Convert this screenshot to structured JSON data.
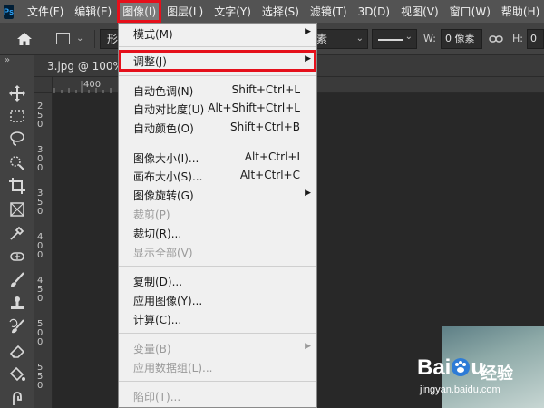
{
  "menubar": {
    "logo": "Ps",
    "items": [
      {
        "label": "文件(F)"
      },
      {
        "label": "编辑(E)"
      },
      {
        "label": "图像(I)"
      },
      {
        "label": "图层(L)"
      },
      {
        "label": "文字(Y)"
      },
      {
        "label": "选择(S)"
      },
      {
        "label": "滤镜(T)"
      },
      {
        "label": "3D(D)"
      },
      {
        "label": "视图(V)"
      },
      {
        "label": "窗口(W)"
      },
      {
        "label": "帮助(H)"
      }
    ],
    "active_item": "图像(I)",
    "highlight_color": "#e5101b"
  },
  "options_bar": {
    "home_icon": "home-icon",
    "shape_icon": "rectangle-icon",
    "mode_value": "形",
    "unit_value": "素",
    "stroke_icon": "stroke-line-icon",
    "w_label": "W:",
    "w_value": "0 像素",
    "link_icon": "link-icon",
    "h_label": "H:",
    "h_value": "0"
  },
  "toolbar": {
    "collapse": "»",
    "tools": [
      "move-icon",
      "marquee-icon",
      "lasso-icon",
      "quick-select-icon",
      "crop-icon",
      "frame-icon",
      "eyedropper-icon",
      "healing-brush-icon",
      "brush-icon",
      "clone-stamp-icon",
      "history-brush-icon",
      "eraser-icon",
      "paint-bucket-icon",
      "smudge-icon"
    ]
  },
  "document": {
    "tab_label": "3.jpg @ 100%(",
    "ruler_top": [
      "400"
    ],
    "ruler_left": [
      "250",
      "300",
      "350",
      "400",
      "450",
      "500",
      "550"
    ]
  },
  "image_menu": {
    "items": [
      {
        "label": "模式(M)",
        "submenu": true
      },
      {
        "label": "调整(J)",
        "submenu": true,
        "highlight": true
      },
      {
        "label": "自动色调(N)",
        "shortcut": "Shift+Ctrl+L"
      },
      {
        "label": "自动对比度(U)",
        "shortcut": "Alt+Shift+Ctrl+L"
      },
      {
        "label": "自动颜色(O)",
        "shortcut": "Shift+Ctrl+B"
      },
      {
        "label": "图像大小(I)...",
        "shortcut": "Alt+Ctrl+I"
      },
      {
        "label": "画布大小(S)...",
        "shortcut": "Alt+Ctrl+C"
      },
      {
        "label": "图像旋转(G)",
        "submenu": true
      },
      {
        "label": "裁剪(P)",
        "disabled": true
      },
      {
        "label": "裁切(R)..."
      },
      {
        "label": "显示全部(V)",
        "disabled": true
      },
      {
        "label": "复制(D)..."
      },
      {
        "label": "应用图像(Y)..."
      },
      {
        "label": "计算(C)..."
      },
      {
        "label": "变量(B)",
        "submenu": true,
        "disabled": true
      },
      {
        "label": "应用数据组(L)...",
        "disabled": true
      },
      {
        "label": "陷印(T)...",
        "disabled": true
      }
    ]
  },
  "watermark": {
    "logo_left": "Bai",
    "logo_right": "u",
    "paw_icon": "baidu-paw-icon",
    "cn_text": "经验",
    "url": "jingyan.baidu.com"
  }
}
